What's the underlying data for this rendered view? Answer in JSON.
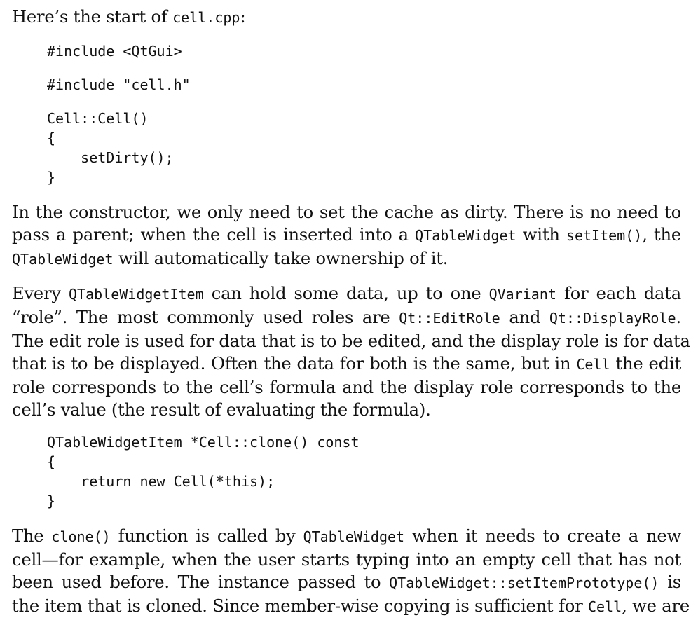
{
  "intro": {
    "t1": "Here’s the start of ",
    "c1": "cell.cpp",
    "t2": ":"
  },
  "code1": {
    "l1": "#include <QtGui>",
    "l2": "#include \"cell.h\"",
    "l3": "Cell::Cell()",
    "l4": "{",
    "l5": "    setDirty();",
    "l6": "}"
  },
  "para1": {
    "l1a": "In the constructor, we only need to set the cache as dirty.  There is no need to",
    "l2a": "pass a parent; when the cell is inserted into a ",
    "l2b": "QTableWidget",
    "l2c": " with ",
    "l2d": "setItem()",
    "l2e": ", the",
    "l3a": "QTableWidget",
    "l3b": " will automatically take ownership of it."
  },
  "para2": {
    "l1a": "Every ",
    "l1b": "QTableWidgetItem",
    "l1c": " can hold some data, up to one ",
    "l1d": "QVariant",
    "l1e": " for each data",
    "l2a": "“role”. The most commonly used roles are ",
    "l2b": "Qt::EditRole",
    "l2c": " and ",
    "l2d": "Qt::DisplayRole",
    "l2e": ".",
    "l3": "The edit role is used for data that is to be edited, and the display role is for data",
    "l4a": "that is to be displayed.  Often the data for both is the same, but in ",
    "l4b": "Cell",
    "l4c": " the edit",
    "l5": "role corresponds to the cell’s formula and the display role corresponds to the",
    "l6": "cell’s value (the result of evaluating the formula)."
  },
  "code2": {
    "l1": "QTableWidgetItem *Cell::clone() const",
    "l2": "{",
    "l3": "    return new Cell(*this);",
    "l4": "}"
  },
  "para3": {
    "l1a": "The ",
    "l1b": "clone()",
    "l1c": " function is called by ",
    "l1d": "QTableWidget",
    "l1e": " when it needs to create a new",
    "l2": "cell—for example, when the user starts typing into an empty cell that has not",
    "l3a": "been used before.  The instance passed to ",
    "l3b": "QTableWidget::setItemPrototype()",
    "l3c": " is",
    "l4a": "the item that is cloned.  Since member-wise copying is sufficient for ",
    "l4b": "Cell",
    "l4c": ", we are"
  }
}
